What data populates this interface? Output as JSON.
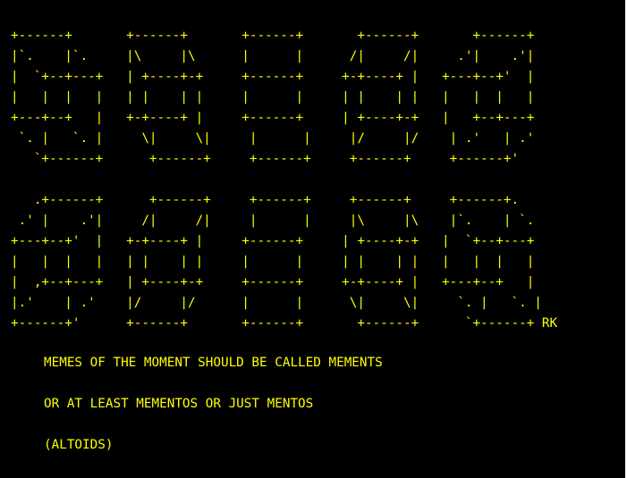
{
  "terminal": {
    "background": "#000000",
    "text_color": "#ffff00",
    "art_lines": [
      "+------+       +------+       +------+       +------+       +------+",
      "|`.    |`.     |\\     |\\      |      |      /|     /|     .'|    .'|",
      "|  `+--+---+   | +----+-+     +------+     +-+----+ |   +---+--+'  |",
      "|   |  |   |   | |    | |     |      |     | |    | |   |   |  |   |",
      "+---+--+   |   +-+----+ |     +------+     | +----+-+   |   +--+---+",
      " `. |   `. |     \\|     \\|     |      |     |/     |/    | .'   | .'",
      "   `+------+      +------+     +------+     +------+     +------+'",
      "",
      "   .+------+      +------+     +------+     +------+     +------+.",
      " .' |    .'|     /|     /|     |      |     |\\     |\\    |`.    | `.",
      "+---+--+'  |   +-+----+ |     +------+     | +----+-+   |  `+--+---+",
      "|   |  |   |   | |    | |     |      |     | |    | |   |   |  |   |",
      "|  ,+--+---+   | +----+-+     +------+     +-+----+ |   +---+--+   |",
      "|.'    | .'    |/     |/      |      |      \\|     \\|     `. |   `. |",
      "+------+'      +------+       +------+       +------+      `+------+ RK"
    ],
    "messages": [
      "MEMES OF THE MOMENT SHOULD BE CALLED MEMENTS",
      "OR AT LEAST MEMENTOS OR JUST MENTOS",
      "(ALTOIDS)"
    ]
  }
}
